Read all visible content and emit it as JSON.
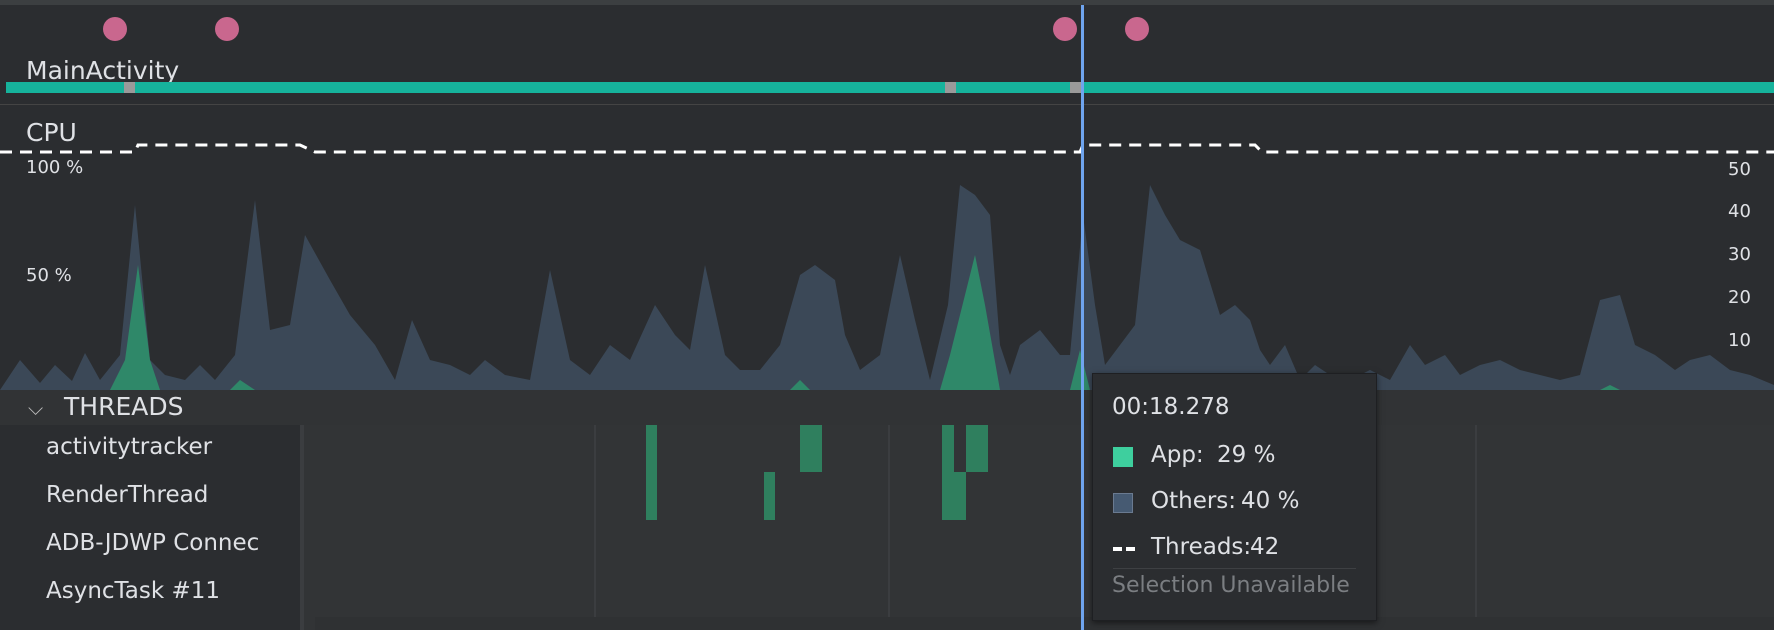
{
  "activity": {
    "label": "MainActivity"
  },
  "cpu": {
    "label": "CPU",
    "left_axis": [
      "100 %",
      "50 %"
    ],
    "right_axis": [
      "50",
      "40",
      "30",
      "20",
      "10"
    ]
  },
  "threads": {
    "title": "THREADS",
    "items": [
      "activitytracker",
      "RenderThread",
      "ADB-JDWP Connec",
      "AsyncTask #11"
    ]
  },
  "tooltip": {
    "time": "00:18.278",
    "app_label": "App:",
    "app_value": "29 %",
    "others_label": "Others:",
    "others_value": "40 %",
    "threads_label": "Threads:",
    "threads_value": "42",
    "footer": "Selection Unavailable"
  },
  "colors": {
    "app": "#3ecf9e",
    "others": "#465a72",
    "activity_bar": "#16b39c",
    "event_dot": "#c9678e",
    "cursor": "#6fa4ee"
  }
}
